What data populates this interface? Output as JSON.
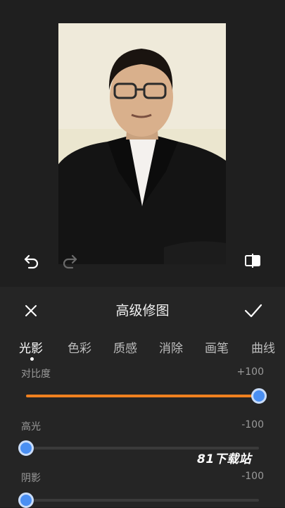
{
  "header": {
    "title": "高级修图"
  },
  "tabs": [
    "光影",
    "色彩",
    "质感",
    "消除",
    "画笔",
    "曲线"
  ],
  "active_tab": 0,
  "sliders": [
    {
      "label": "对比度",
      "value": "+100",
      "level": 1.0
    },
    {
      "label": "高光",
      "value": "-100",
      "level": 0.0
    },
    {
      "label": "阴影",
      "value": "-100",
      "level": 0.0
    }
  ],
  "watermark": "81下载站",
  "colors": {
    "accent_fill": "#f0801f",
    "knob": "#4a8ff2",
    "panel_bg": "#252525",
    "preview_bg": "#1f1f1f"
  },
  "icons": {
    "undo": "undo-icon",
    "redo": "redo-icon",
    "compare": "compare-icon",
    "close": "close-icon",
    "confirm": "check-icon"
  }
}
